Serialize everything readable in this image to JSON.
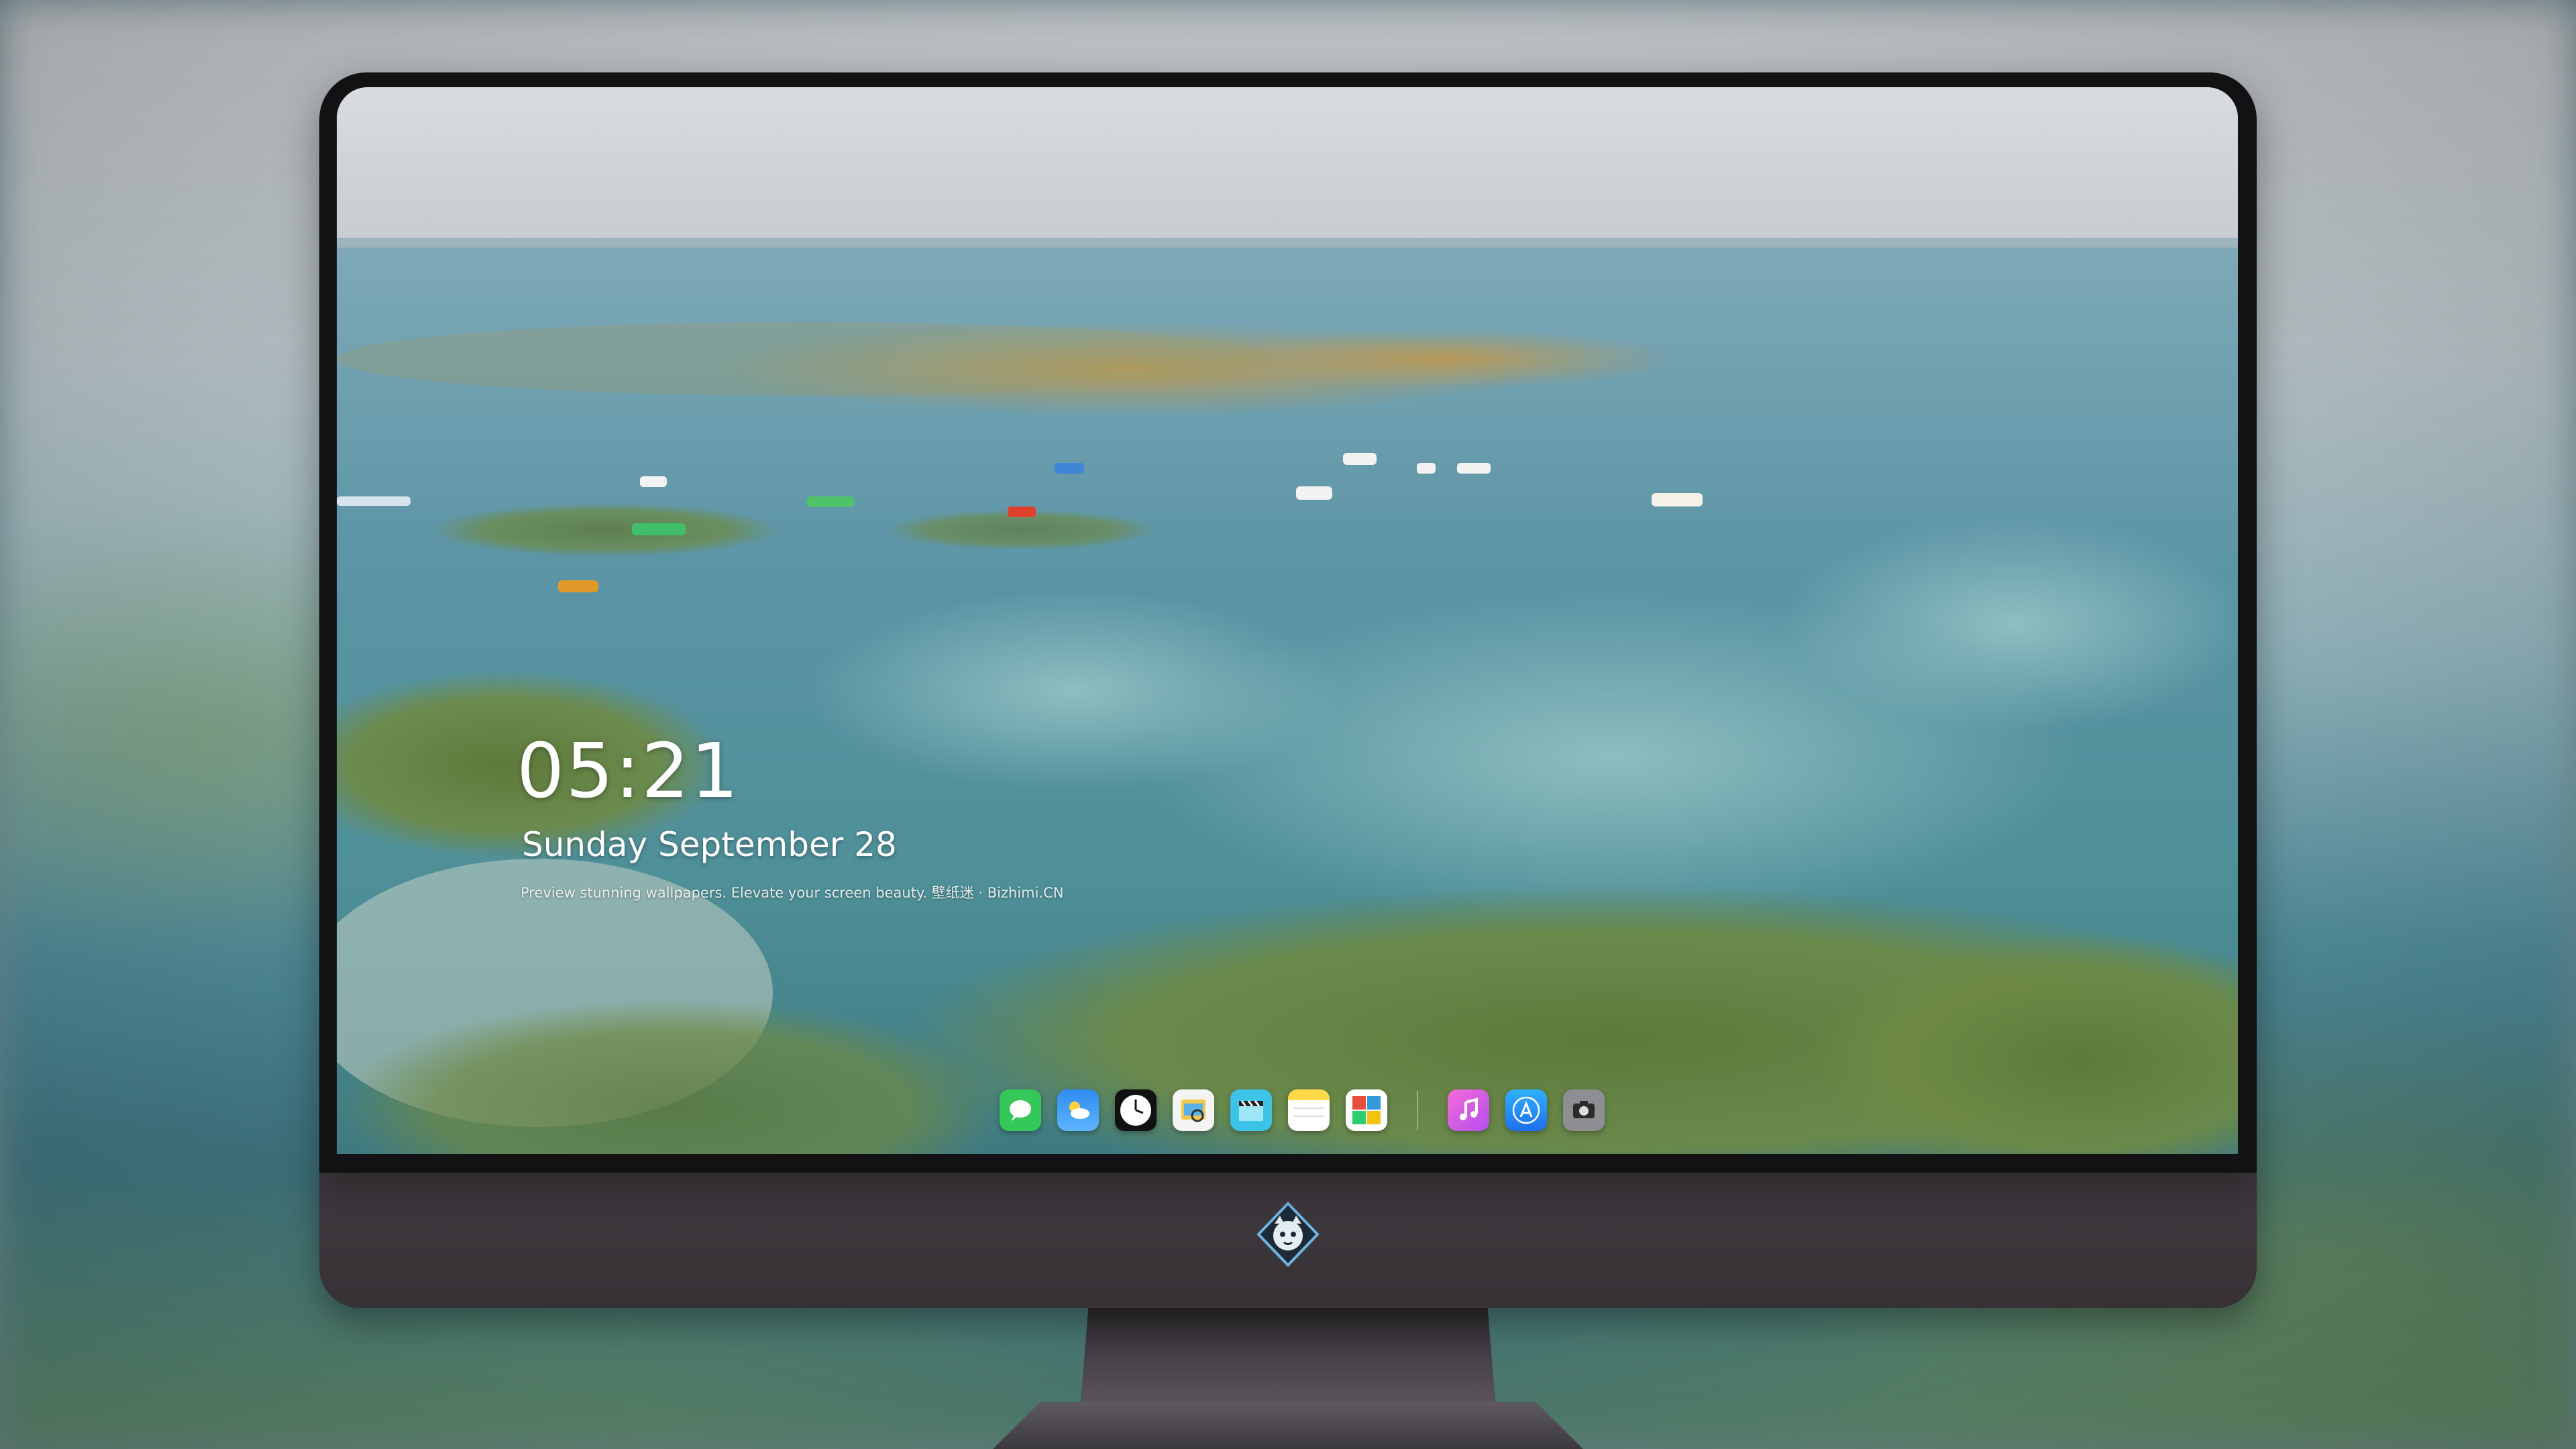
{
  "lockscreen": {
    "time": "05:21",
    "date": "Sunday September  28",
    "tagline": "Preview stunning wallpapers. Elevate your screen beauty. 壁纸迷 · Bizhimi.CN"
  },
  "dock": {
    "apps": [
      {
        "name": "messages-icon",
        "color": "#34c759"
      },
      {
        "name": "weather-icon",
        "color": "#2f8cf0"
      },
      {
        "name": "clock-icon",
        "color": "#ffffff"
      },
      {
        "name": "preview-icon",
        "color": "#f2c94c"
      },
      {
        "name": "clips-icon",
        "color": "#3cc4e8"
      },
      {
        "name": "notes-icon",
        "color": "#ffd84a"
      },
      {
        "name": "photo-booth-icon",
        "color": "#e74c3c"
      },
      {
        "name": "itunes-icon",
        "color": "#e85ad6"
      },
      {
        "name": "app-store-icon",
        "color": "#1e8ef0"
      },
      {
        "name": "camera-icon",
        "color": "#8e8e93"
      }
    ]
  },
  "colors": {
    "monitor_bezel": "#121114",
    "monitor_chin": "#3f3a3f",
    "sea": "#5c8a98",
    "sky": "#c9ccd0"
  }
}
